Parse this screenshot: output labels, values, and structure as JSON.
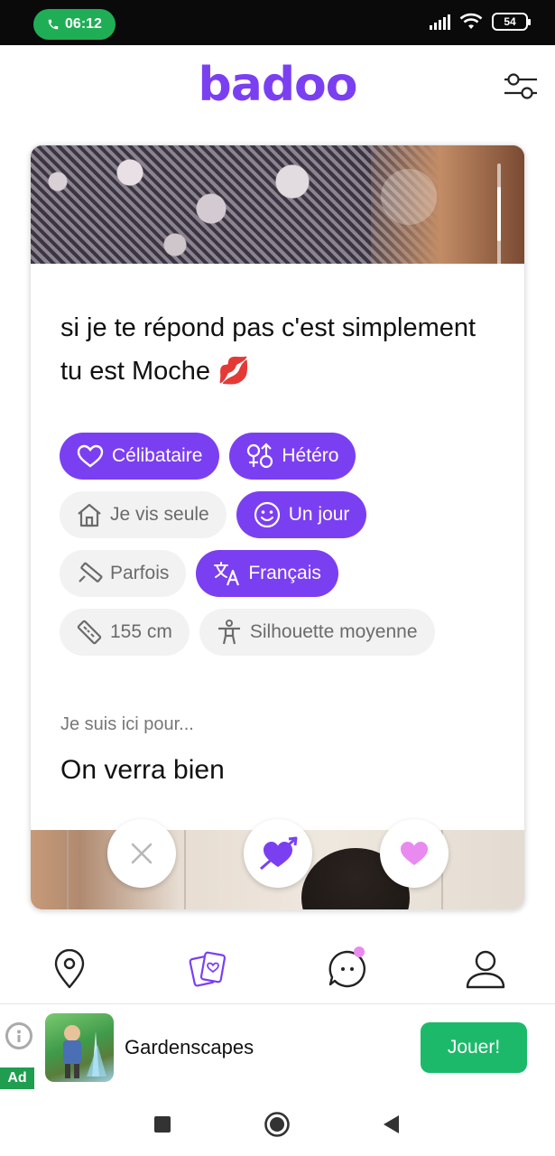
{
  "status_bar": {
    "time": "06:12",
    "battery": "54",
    "icons": [
      "phone-icon",
      "signal-icon",
      "wifi-icon",
      "battery-icon"
    ]
  },
  "header": {
    "logo": "badoo",
    "filter_icon": "sliders-icon"
  },
  "profile": {
    "bio": "si je te répond pas c'est simplement tu est Moche 💋",
    "chips": [
      {
        "label": "Célibataire",
        "icon": "heart-outline-icon",
        "style": "purple"
      },
      {
        "label": "Hétéro",
        "icon": "gender-icon",
        "style": "purple"
      },
      {
        "label": "Je vis seule",
        "icon": "house-icon",
        "style": "grey"
      },
      {
        "label": "Un jour",
        "icon": "smiley-icon",
        "style": "purple"
      },
      {
        "label": "Parfois",
        "icon": "cigarette-icon",
        "style": "grey"
      },
      {
        "label": "Français",
        "icon": "translate-icon",
        "style": "purple"
      },
      {
        "label": "155 cm",
        "icon": "ruler-icon",
        "style": "grey"
      },
      {
        "label": "Silhouette moyenne",
        "icon": "body-icon",
        "style": "grey"
      }
    ],
    "section_label": "Je suis ici pour...",
    "section_value": "On verra bien"
  },
  "actions": {
    "pass_icon": "close-icon",
    "crush_icon": "heart-arrow-icon",
    "like_icon": "heart-icon"
  },
  "bottom_nav": {
    "items": [
      "location-pin-icon",
      "cards-icon",
      "chat-icon",
      "profile-icon"
    ]
  },
  "ad": {
    "label": "Ad",
    "title": "Gardenscapes",
    "cta": "Jouer!"
  },
  "colors": {
    "brand": "#7b3ff2",
    "chip_grey": "#f2f2f2",
    "ad_green": "#1db96a",
    "status_green": "#1fae55",
    "like_pink": "#e98af0"
  }
}
